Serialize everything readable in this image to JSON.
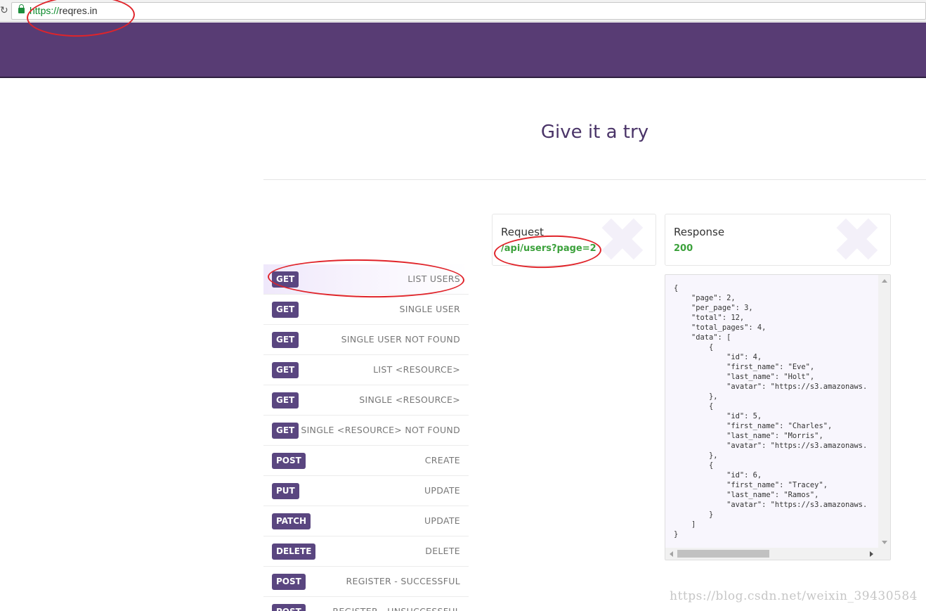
{
  "browser": {
    "url_scheme": "https://",
    "url_host": "reqres.in"
  },
  "page": {
    "title": "Give it a try"
  },
  "endpoints": [
    {
      "method": "GET",
      "label": "LIST USERS",
      "active": true
    },
    {
      "method": "GET",
      "label": "SINGLE USER"
    },
    {
      "method": "GET",
      "label": "SINGLE USER NOT FOUND"
    },
    {
      "method": "GET",
      "label": "LIST <RESOURCE>"
    },
    {
      "method": "GET",
      "label": "SINGLE <RESOURCE>"
    },
    {
      "method": "GET",
      "label": "SINGLE <RESOURCE> NOT FOUND"
    },
    {
      "method": "POST",
      "label": "CREATE"
    },
    {
      "method": "PUT",
      "label": "UPDATE"
    },
    {
      "method": "PATCH",
      "label": "UPDATE"
    },
    {
      "method": "DELETE",
      "label": "DELETE"
    },
    {
      "method": "POST",
      "label": "REGISTER - SUCCESSFUL"
    },
    {
      "method": "POST",
      "label": "REGISTER - UNSUCCESSFUL"
    }
  ],
  "request": {
    "heading": "Request",
    "path": "/api/users?page=2"
  },
  "response": {
    "heading": "Response",
    "status": "200",
    "body": "{\n    \"page\": 2,\n    \"per_page\": 3,\n    \"total\": 12,\n    \"total_pages\": 4,\n    \"data\": [\n        {\n            \"id\": 4,\n            \"first_name\": \"Eve\",\n            \"last_name\": \"Holt\",\n            \"avatar\": \"https://s3.amazonaws.\n        },\n        {\n            \"id\": 5,\n            \"first_name\": \"Charles\",\n            \"last_name\": \"Morris\",\n            \"avatar\": \"https://s3.amazonaws.\n        },\n        {\n            \"id\": 6,\n            \"first_name\": \"Tracey\",\n            \"last_name\": \"Ramos\",\n            \"avatar\": \"https://s3.amazonaws.\n        }\n    ]\n}"
  },
  "watermark_text": "https://blog.csdn.net/weixin_39430584",
  "colors": {
    "header": "#583c74",
    "badge": "#5a4680",
    "status_green": "#3ba13b",
    "annotation_red": "#e0242a"
  },
  "icons": {
    "reload": "reload-icon",
    "lock": "lock-icon"
  }
}
